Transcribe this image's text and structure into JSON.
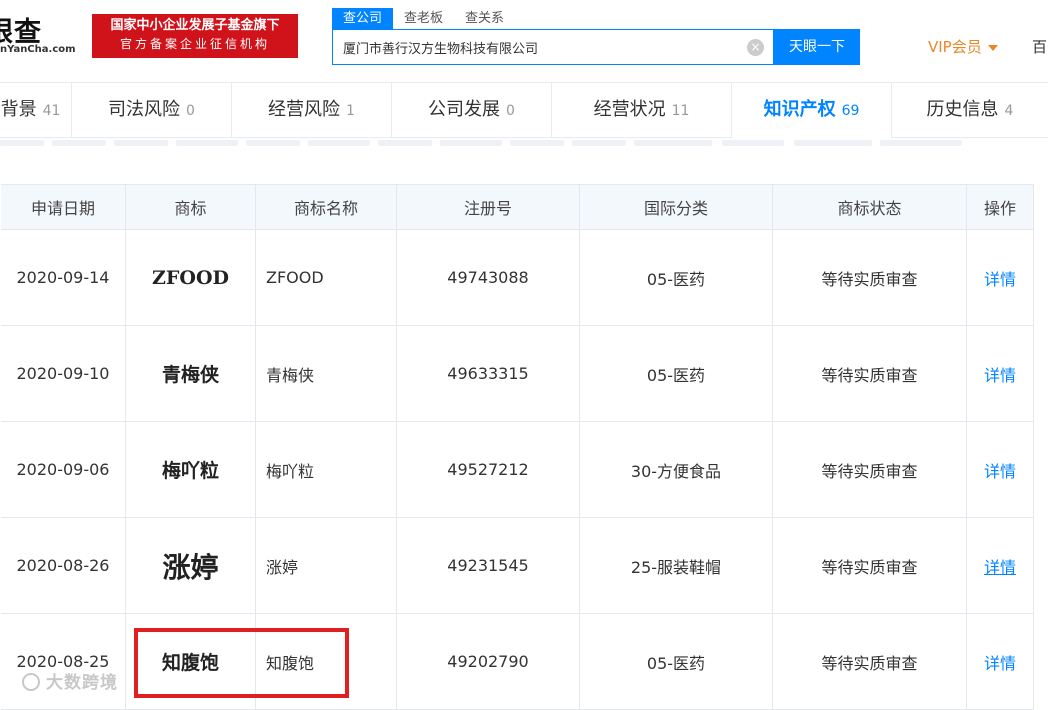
{
  "header": {
    "logo_main": "天眼查",
    "logo_sub": "nYanCha.com",
    "slogan_line1": "国家中小企业发展子基金旗下",
    "slogan_line2": "官方备案企业征信机构",
    "search_tabs": [
      "查公司",
      "查老板",
      "查关系"
    ],
    "search_value": "厦门市善行汉方生物科技有限公司",
    "search_button": "天眼一下",
    "vip_label": "VIP会员",
    "more_label": "百"
  },
  "nav": {
    "items": [
      {
        "label": "背景",
        "count": "41"
      },
      {
        "label": "司法风险",
        "count": "0"
      },
      {
        "label": "经营风险",
        "count": "1"
      },
      {
        "label": "公司发展",
        "count": "0"
      },
      {
        "label": "经营状况",
        "count": "11"
      },
      {
        "label": "知识产权",
        "count": "69"
      },
      {
        "label": "历史信息",
        "count": "4"
      }
    ],
    "active": "知识产权"
  },
  "table": {
    "columns": [
      "申请日期",
      "商标",
      "商标名称",
      "注册号",
      "国际分类",
      "商标状态",
      "操作"
    ],
    "rows": [
      {
        "date": "2020-09-14",
        "mark": "ZFOOD",
        "name": "ZFOOD",
        "reg_no": "49743088",
        "class": "05-医药",
        "status": "等待实质审查",
        "action": "详情"
      },
      {
        "date": "2020-09-10",
        "mark": "青梅侠",
        "name": "青梅侠",
        "reg_no": "49633315",
        "class": "05-医药",
        "status": "等待实质审查",
        "action": "详情"
      },
      {
        "date": "2020-09-06",
        "mark": "梅吖粒",
        "name": "梅吖粒",
        "reg_no": "49527212",
        "class": "30-方便食品",
        "status": "等待实质审查",
        "action": "详情"
      },
      {
        "date": "2020-08-26",
        "mark": "涨婷",
        "name": "涨婷",
        "reg_no": "49231545",
        "class": "25-服装鞋帽",
        "status": "等待实质审查",
        "action": "详情"
      },
      {
        "date": "2020-08-25",
        "mark": "知腹饱",
        "name": "知腹饱",
        "reg_no": "49202790",
        "class": "05-医药",
        "status": "等待实质审查",
        "action": "详情"
      }
    ]
  },
  "watermark": "大数跨境",
  "colors": {
    "accent": "#0084ff",
    "slogan_red": "#d0121b",
    "vip_orange": "#e8882a",
    "highlight_red": "#e02020"
  }
}
